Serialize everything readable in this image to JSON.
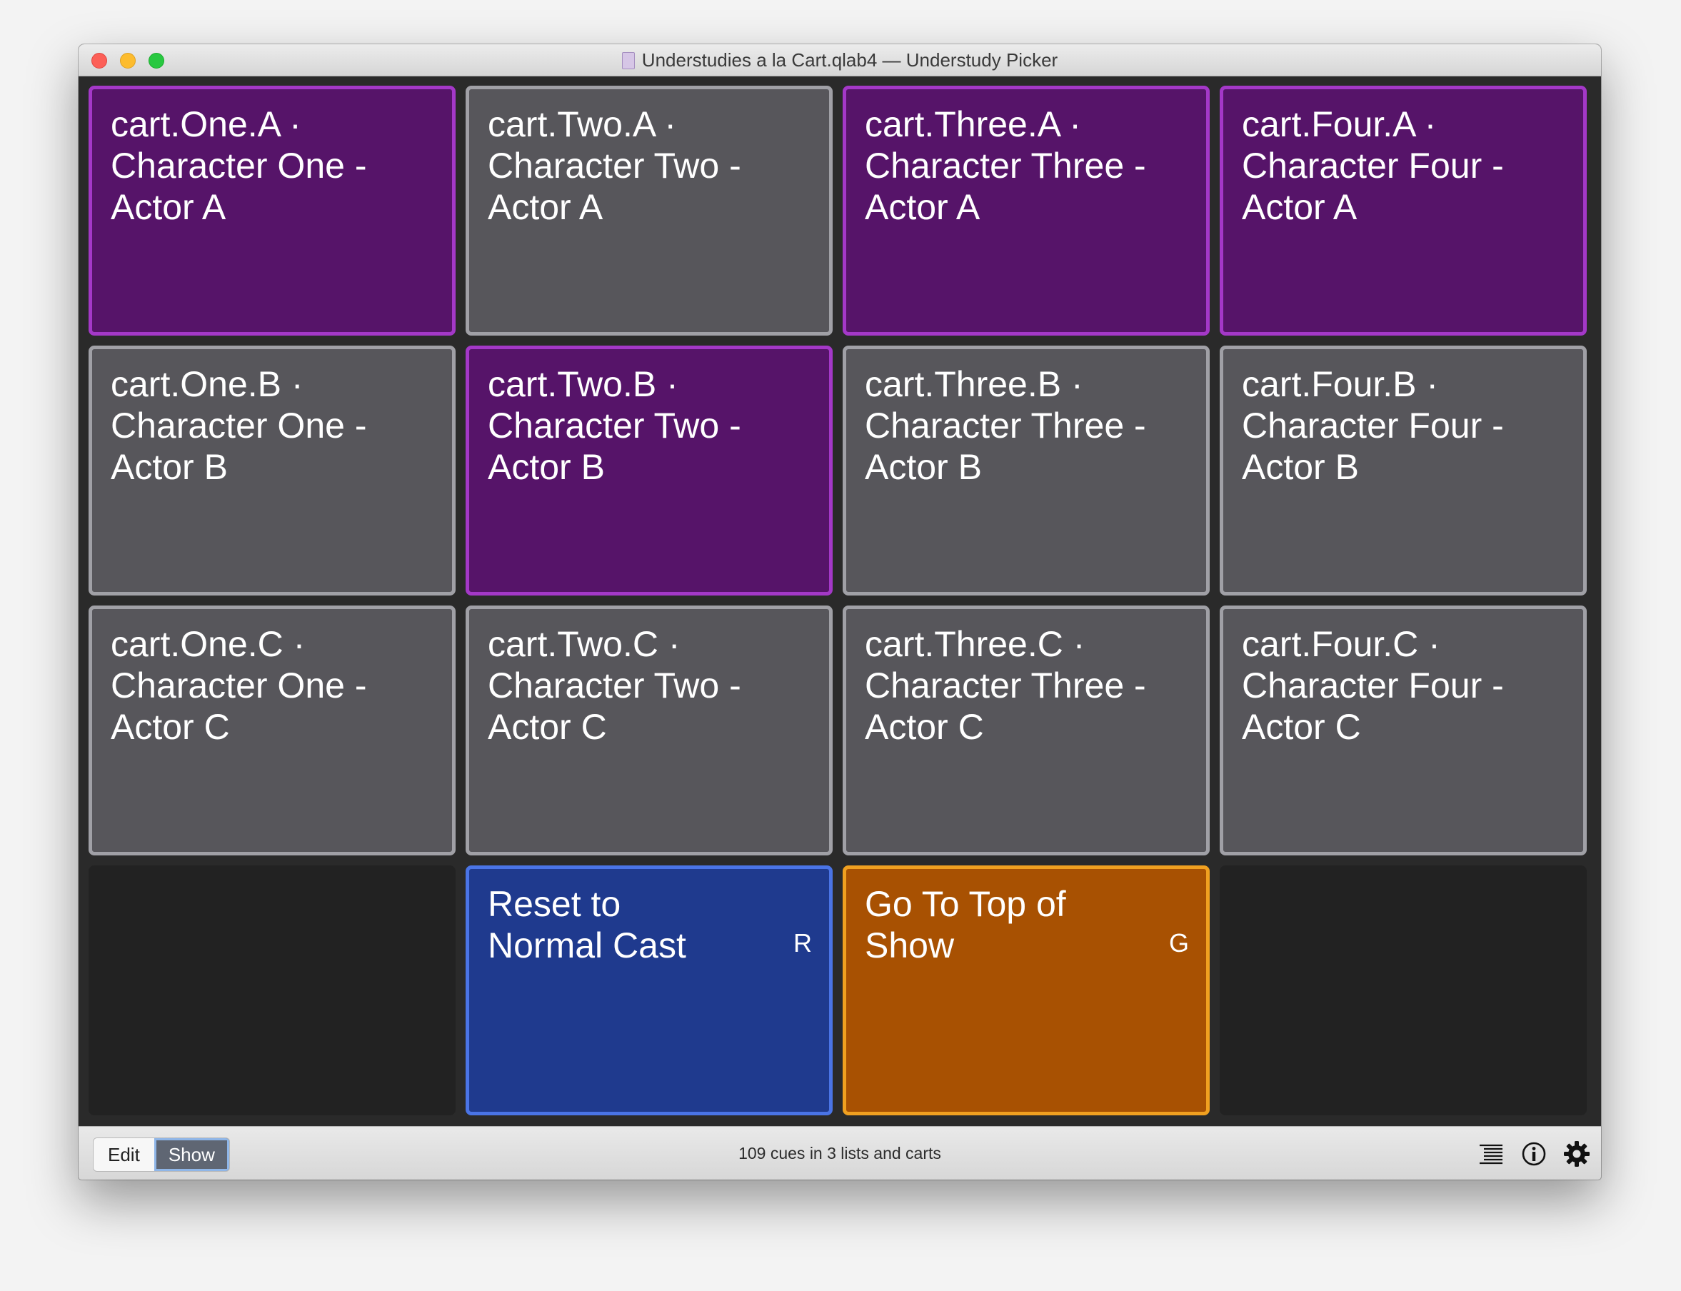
{
  "window": {
    "title": "Understudies a la Cart.qlab4 — Understudy Picker"
  },
  "cart": {
    "tiles": [
      {
        "label": "cart.One.A · Character One - Actor A",
        "state": "active"
      },
      {
        "label": "cart.Two.A · Character Two - Actor A",
        "state": "inactive"
      },
      {
        "label": "cart.Three.A · Character Three - Actor A",
        "state": "active"
      },
      {
        "label": "cart.Four.A · Character Four - Actor A",
        "state": "active"
      },
      {
        "label": "cart.One.B · Character One - Actor B",
        "state": "inactive"
      },
      {
        "label": "cart.Two.B · Character Two - Actor B",
        "state": "active"
      },
      {
        "label": "cart.Three.B · Character Three - Actor B",
        "state": "inactive"
      },
      {
        "label": "cart.Four.B · Character Four - Actor B",
        "state": "inactive"
      },
      {
        "label": "cart.One.C · Character One - Actor C",
        "state": "inactive"
      },
      {
        "label": "cart.Two.C · Character Two - Actor C",
        "state": "inactive"
      },
      {
        "label": "cart.Three.C · Character Three - Actor C",
        "state": "inactive"
      },
      {
        "label": "cart.Four.C · Character Four - Actor C",
        "state": "inactive"
      }
    ],
    "reset": {
      "label": "Reset to Normal Cast",
      "hotkey": "R"
    },
    "goto_top": {
      "label": "Go To Top of Show",
      "hotkey": "G"
    }
  },
  "statusbar": {
    "edit_label": "Edit",
    "show_label": "Show",
    "mode": "Show",
    "status_text": "109 cues in 3 lists and carts",
    "icons": [
      "list-icon",
      "info-icon",
      "gear-icon"
    ]
  },
  "colors": {
    "active_tile": "#561469",
    "active_border": "#a438c8",
    "inactive_tile": "#57565b",
    "reset_tile": "#1f3a8e",
    "goto_tile": "#a85102"
  }
}
